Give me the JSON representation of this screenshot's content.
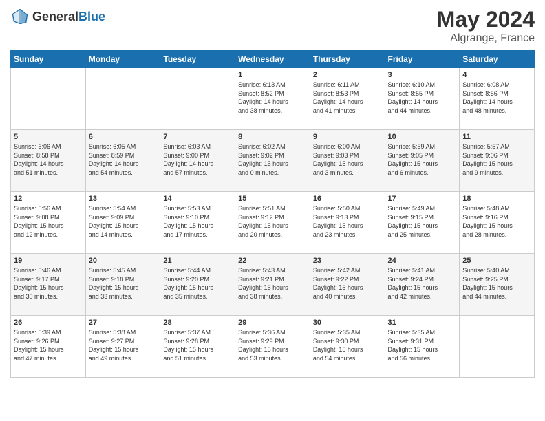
{
  "header": {
    "logo_general": "General",
    "logo_blue": "Blue",
    "title": "May 2024",
    "location": "Algrange, France"
  },
  "weekdays": [
    "Sunday",
    "Monday",
    "Tuesday",
    "Wednesday",
    "Thursday",
    "Friday",
    "Saturday"
  ],
  "weeks": [
    [
      {
        "day": "",
        "info": ""
      },
      {
        "day": "",
        "info": ""
      },
      {
        "day": "",
        "info": ""
      },
      {
        "day": "1",
        "info": "Sunrise: 6:13 AM\nSunset: 8:52 PM\nDaylight: 14 hours\nand 38 minutes."
      },
      {
        "day": "2",
        "info": "Sunrise: 6:11 AM\nSunset: 8:53 PM\nDaylight: 14 hours\nand 41 minutes."
      },
      {
        "day": "3",
        "info": "Sunrise: 6:10 AM\nSunset: 8:55 PM\nDaylight: 14 hours\nand 44 minutes."
      },
      {
        "day": "4",
        "info": "Sunrise: 6:08 AM\nSunset: 8:56 PM\nDaylight: 14 hours\nand 48 minutes."
      }
    ],
    [
      {
        "day": "5",
        "info": "Sunrise: 6:06 AM\nSunset: 8:58 PM\nDaylight: 14 hours\nand 51 minutes."
      },
      {
        "day": "6",
        "info": "Sunrise: 6:05 AM\nSunset: 8:59 PM\nDaylight: 14 hours\nand 54 minutes."
      },
      {
        "day": "7",
        "info": "Sunrise: 6:03 AM\nSunset: 9:00 PM\nDaylight: 14 hours\nand 57 minutes."
      },
      {
        "day": "8",
        "info": "Sunrise: 6:02 AM\nSunset: 9:02 PM\nDaylight: 15 hours\nand 0 minutes."
      },
      {
        "day": "9",
        "info": "Sunrise: 6:00 AM\nSunset: 9:03 PM\nDaylight: 15 hours\nand 3 minutes."
      },
      {
        "day": "10",
        "info": "Sunrise: 5:59 AM\nSunset: 9:05 PM\nDaylight: 15 hours\nand 6 minutes."
      },
      {
        "day": "11",
        "info": "Sunrise: 5:57 AM\nSunset: 9:06 PM\nDaylight: 15 hours\nand 9 minutes."
      }
    ],
    [
      {
        "day": "12",
        "info": "Sunrise: 5:56 AM\nSunset: 9:08 PM\nDaylight: 15 hours\nand 12 minutes."
      },
      {
        "day": "13",
        "info": "Sunrise: 5:54 AM\nSunset: 9:09 PM\nDaylight: 15 hours\nand 14 minutes."
      },
      {
        "day": "14",
        "info": "Sunrise: 5:53 AM\nSunset: 9:10 PM\nDaylight: 15 hours\nand 17 minutes."
      },
      {
        "day": "15",
        "info": "Sunrise: 5:51 AM\nSunset: 9:12 PM\nDaylight: 15 hours\nand 20 minutes."
      },
      {
        "day": "16",
        "info": "Sunrise: 5:50 AM\nSunset: 9:13 PM\nDaylight: 15 hours\nand 23 minutes."
      },
      {
        "day": "17",
        "info": "Sunrise: 5:49 AM\nSunset: 9:15 PM\nDaylight: 15 hours\nand 25 minutes."
      },
      {
        "day": "18",
        "info": "Sunrise: 5:48 AM\nSunset: 9:16 PM\nDaylight: 15 hours\nand 28 minutes."
      }
    ],
    [
      {
        "day": "19",
        "info": "Sunrise: 5:46 AM\nSunset: 9:17 PM\nDaylight: 15 hours\nand 30 minutes."
      },
      {
        "day": "20",
        "info": "Sunrise: 5:45 AM\nSunset: 9:18 PM\nDaylight: 15 hours\nand 33 minutes."
      },
      {
        "day": "21",
        "info": "Sunrise: 5:44 AM\nSunset: 9:20 PM\nDaylight: 15 hours\nand 35 minutes."
      },
      {
        "day": "22",
        "info": "Sunrise: 5:43 AM\nSunset: 9:21 PM\nDaylight: 15 hours\nand 38 minutes."
      },
      {
        "day": "23",
        "info": "Sunrise: 5:42 AM\nSunset: 9:22 PM\nDaylight: 15 hours\nand 40 minutes."
      },
      {
        "day": "24",
        "info": "Sunrise: 5:41 AM\nSunset: 9:24 PM\nDaylight: 15 hours\nand 42 minutes."
      },
      {
        "day": "25",
        "info": "Sunrise: 5:40 AM\nSunset: 9:25 PM\nDaylight: 15 hours\nand 44 minutes."
      }
    ],
    [
      {
        "day": "26",
        "info": "Sunrise: 5:39 AM\nSunset: 9:26 PM\nDaylight: 15 hours\nand 47 minutes."
      },
      {
        "day": "27",
        "info": "Sunrise: 5:38 AM\nSunset: 9:27 PM\nDaylight: 15 hours\nand 49 minutes."
      },
      {
        "day": "28",
        "info": "Sunrise: 5:37 AM\nSunset: 9:28 PM\nDaylight: 15 hours\nand 51 minutes."
      },
      {
        "day": "29",
        "info": "Sunrise: 5:36 AM\nSunset: 9:29 PM\nDaylight: 15 hours\nand 53 minutes."
      },
      {
        "day": "30",
        "info": "Sunrise: 5:35 AM\nSunset: 9:30 PM\nDaylight: 15 hours\nand 54 minutes."
      },
      {
        "day": "31",
        "info": "Sunrise: 5:35 AM\nSunset: 9:31 PM\nDaylight: 15 hours\nand 56 minutes."
      },
      {
        "day": "",
        "info": ""
      }
    ]
  ]
}
